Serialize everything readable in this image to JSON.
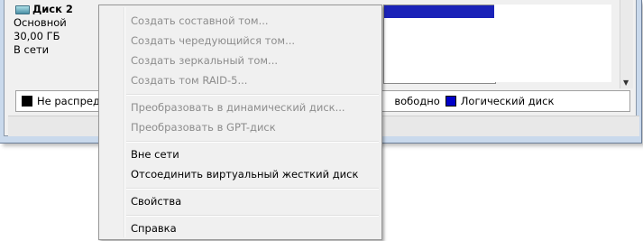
{
  "disk": {
    "name": "Диск 2",
    "type": "Основной",
    "size": "30,00 ГБ",
    "status": "В сети"
  },
  "legend": {
    "items": [
      {
        "label": "Не распредел",
        "color": "#000000"
      },
      {
        "label": "вободно"
      },
      {
        "label": "Логический диск",
        "color": "#0000c8"
      }
    ]
  },
  "context_menu": {
    "items": [
      {
        "label": "Создать составной том...",
        "enabled": false
      },
      {
        "label": "Создать чередующийся том...",
        "enabled": false
      },
      {
        "label": "Создать зеркальный том...",
        "enabled": false
      },
      {
        "label": "Создать том RAID-5...",
        "enabled": false
      },
      {
        "label": "Преобразовать в динамический диск...",
        "enabled": false
      },
      {
        "label": "Преобразовать в GPT-диск",
        "enabled": false
      },
      {
        "label": "Вне сети",
        "enabled": true
      },
      {
        "label": "Отсоединить виртуальный жесткий диск",
        "enabled": true
      },
      {
        "label": "Свойства",
        "enabled": true
      },
      {
        "label": "Справка",
        "enabled": true
      }
    ]
  },
  "colors": {
    "partition_bar": "#1a22b8",
    "disabled_text": "#8d8d8d"
  }
}
